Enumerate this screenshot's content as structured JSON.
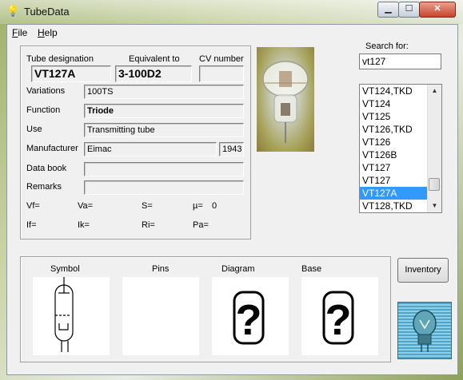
{
  "window": {
    "title": "TubeData"
  },
  "menu": [
    {
      "label": "File",
      "accel": "F",
      "rest": "ile"
    },
    {
      "label": "Help",
      "accel": "H",
      "rest": "elp"
    }
  ],
  "labels": {
    "tube_designation": "Tube designation",
    "equivalent_to": "Equivalent to",
    "cv_number": "CV number",
    "variations": "Variations",
    "function": "Function",
    "use": "Use",
    "manufacturer": "Manufacturer",
    "data_book": "Data book",
    "remarks": "Remarks",
    "vf": "Vf=",
    "va": "Va=",
    "s": "S=",
    "mu": "µ=",
    "if": "If=",
    "ik": "Ik=",
    "ri": "Ri=",
    "pa": "Pa=",
    "search_for": "Search for:",
    "symbol": "Symbol",
    "pins": "Pins",
    "diagram": "Diagram",
    "base": "Base"
  },
  "values": {
    "tube_designation": "VT127A",
    "equivalent_to": "3-100D2",
    "cv_number": "",
    "variations": "100TS",
    "function": "Triode",
    "use": "Transmitting tube",
    "manufacturer": "Eimac",
    "year": "1943",
    "data_book": "",
    "remarks": "",
    "mu": "0"
  },
  "search": {
    "value": "vt127"
  },
  "list": {
    "items": [
      "VT124,TKD",
      "VT124",
      "VT125",
      "VT126,TKD",
      "VT126",
      "VT126B",
      "VT127",
      "VT127",
      "VT127A",
      "VT128,TKD"
    ],
    "selected_index": 8
  },
  "buttons": {
    "inventory": "Inventory"
  },
  "unknown_glyph": "?"
}
